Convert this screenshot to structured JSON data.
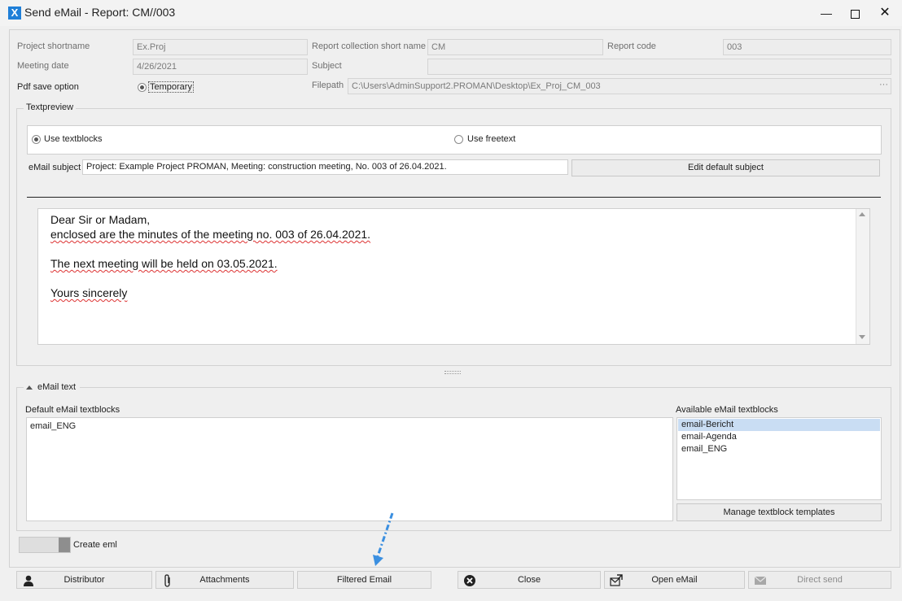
{
  "window": {
    "logo": "X",
    "title": "Send eMail - Report: CM//003",
    "minimize": "—",
    "close": "✕"
  },
  "fields": {
    "project_shortname_label": "Project shortname",
    "project_shortname": "Ex.Proj",
    "report_collection_label": "Report collection short name",
    "report_collection": "CM",
    "report_code_label": "Report code",
    "report_code": "003",
    "meeting_date_label": "Meeting date",
    "meeting_date": "4/26/2021",
    "subject_label": "Subject",
    "subject": "",
    "pdf_save_label": "Pdf save option",
    "pdf_save_value": "Temporary",
    "filepath_label": "Filepath",
    "filepath": "C:\\Users\\AdminSupport2.PROMAN\\Desktop\\Ex_Proj_CM_003",
    "filepath_more": "···"
  },
  "textpreview": {
    "title": "Textpreview",
    "use_textblocks": "Use textblocks",
    "use_freetext": "Use freetext",
    "selected_mode": "Use textblocks",
    "email_subject_label": "eMail subject",
    "email_subject": "Project: Example Project PROMAN, Meeting: construction meeting, No. 003 of 26.04.2021.",
    "edit_default_subject": "Edit default subject",
    "body": {
      "line1": "Dear Sir or Madam,",
      "line2": "enclosed are the minutes of the meeting no. 003 of 26.04.2021.",
      "line3": "The next meeting will be held on 03.05.2021.",
      "line4": "Yours sincerely"
    }
  },
  "email_text": {
    "title": "eMail text",
    "default_label": "Default eMail textblocks",
    "default_items": [
      "email_ENG"
    ],
    "available_label": "Available eMail textblocks",
    "available_items": [
      "email-Bericht",
      "email-Agenda",
      "email_ENG"
    ],
    "selected_available": "email-Bericht",
    "manage_templates": "Manage textblock templates"
  },
  "create_eml": {
    "label": "Create eml"
  },
  "bottom_buttons": {
    "distributor": "Distributor",
    "attachments": "Attachments",
    "filtered_email": "Filtered Email",
    "close": "Close",
    "open_email": "Open eMail",
    "direct_send": "Direct send"
  },
  "colors": {
    "accent_blue": "#1f7fd8",
    "annotation_arrow": "#3b8fe0",
    "selection": "#c9ddf3",
    "spellcheck": "#dd3333"
  }
}
